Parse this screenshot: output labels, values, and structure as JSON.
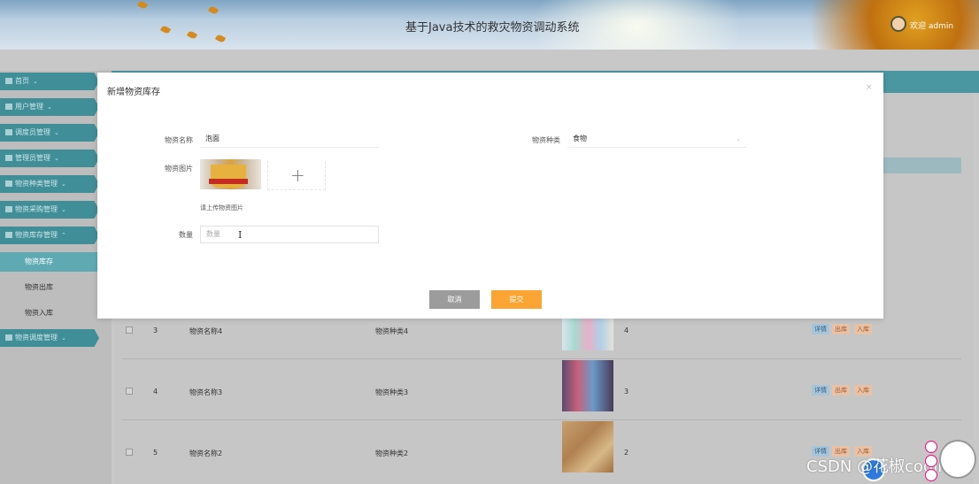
{
  "header": {
    "title": "基于Java技术的救灾物资调动系统",
    "user_name": "欢迎 admin"
  },
  "sidebar": {
    "items": [
      {
        "label": "首页"
      },
      {
        "label": "用户管理"
      },
      {
        "label": "调度员管理"
      },
      {
        "label": "管理员管理"
      },
      {
        "label": "物资种类管理"
      },
      {
        "label": "物资采购管理"
      },
      {
        "label": "物资库存管理"
      },
      {
        "label": "物资调度管理"
      }
    ],
    "sub_items": [
      {
        "label": "物资库存",
        "active": true
      },
      {
        "label": "物资出库"
      },
      {
        "label": "物资入库"
      }
    ]
  },
  "table": {
    "rows": [
      {
        "index": "3",
        "name": "物资名称4",
        "type": "物资种类4",
        "qty": "4"
      },
      {
        "index": "4",
        "name": "物资名称3",
        "type": "物资种类3",
        "qty": "3"
      },
      {
        "index": "5",
        "name": "物资名称2",
        "type": "物资种类2",
        "qty": "2"
      }
    ],
    "actions": {
      "detail": "详情",
      "out": "出库",
      "in": "入库"
    }
  },
  "modal": {
    "title": "新增物资库存",
    "close": "×",
    "fields": {
      "name_label": "物资名称",
      "name_value": "泡面",
      "type_label": "物资种类",
      "type_value": "食物",
      "photo_label": "物资图片",
      "upload_hint": "请上传物资图片",
      "qty_label": "数量",
      "qty_placeholder": "数量"
    },
    "buttons": {
      "cancel": "取消",
      "submit": "提交"
    }
  },
  "watermark": "CSDN @花椒coding",
  "colors": {
    "sidebar_item": "#3f8e98",
    "submit": "#fca534",
    "cancel": "#9c9c9c"
  }
}
